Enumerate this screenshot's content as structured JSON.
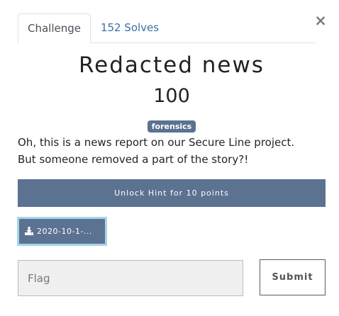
{
  "tabs": [
    {
      "label": "Challenge",
      "active": true
    },
    {
      "label": "152 Solves",
      "active": false
    }
  ],
  "close_label": "×",
  "challenge": {
    "name": "Redacted news",
    "points": "100",
    "tag": "forensics",
    "description": "Oh, this is a news report on our Secure Line project. But someone removed a part of the story?!"
  },
  "hint_button": "Unlock Hint for 10 points",
  "file_button": {
    "icon": "download-icon",
    "label": "2020-10-1-..."
  },
  "flag_input": {
    "placeholder": "Flag",
    "value": ""
  },
  "submit_label": "Submit",
  "colors": {
    "accent": "#5b7290",
    "focus_ring": "#a9d4e8",
    "link": "#3b6fa6"
  }
}
